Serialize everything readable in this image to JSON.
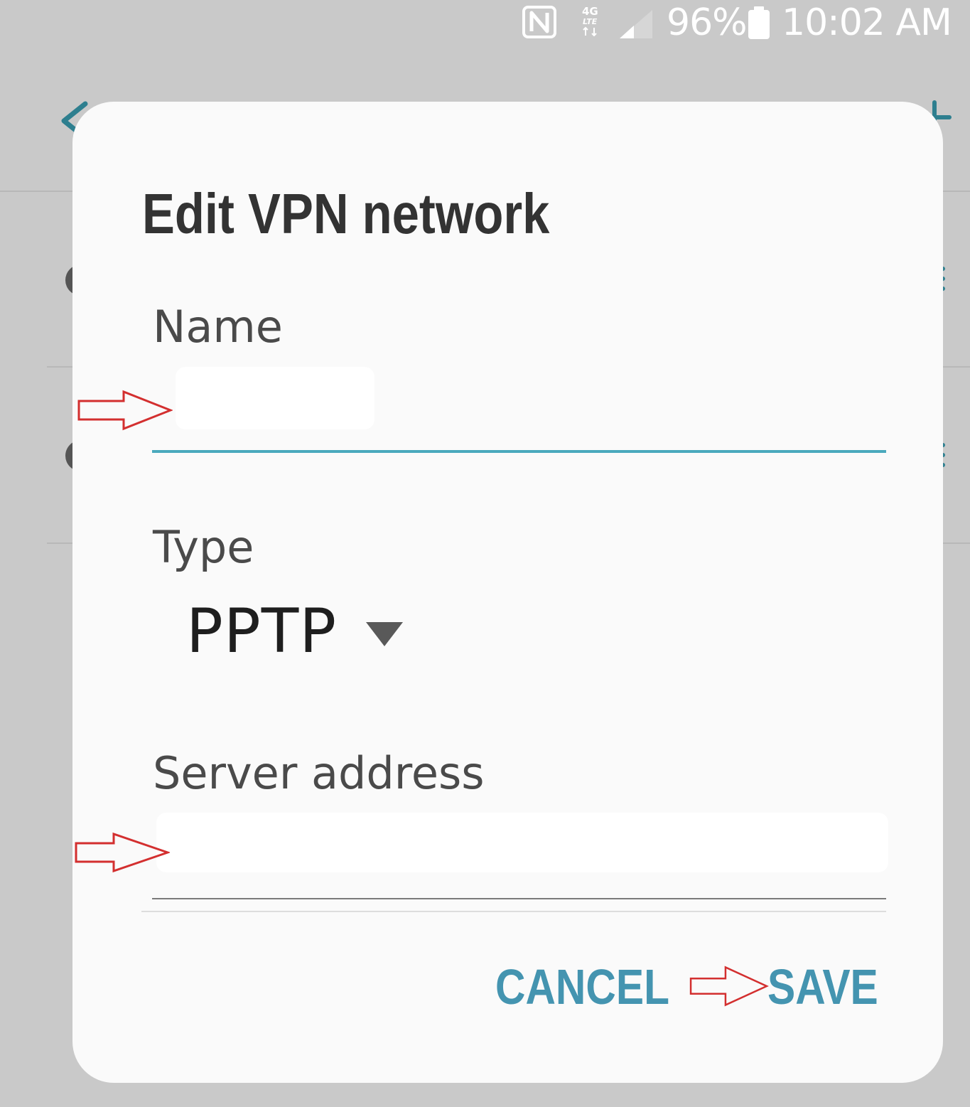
{
  "status_bar": {
    "nfc_icon": "nfc-icon",
    "network_icon": "lte-4g-icon",
    "signal_icon": "signal-strength-icon",
    "battery_percent": "96%",
    "battery_icon": "battery-icon",
    "time": "10:02 AM"
  },
  "background": {
    "back_icon": "back-arrow-icon",
    "add_icon": "add-icon"
  },
  "dialog": {
    "title": "Edit VPN network",
    "name_field": {
      "label": "Name",
      "value": ""
    },
    "type_field": {
      "label": "Type",
      "value": "PPTP",
      "icon": "dropdown-triangle-icon"
    },
    "server_field": {
      "label": "Server address",
      "value": ""
    },
    "buttons": {
      "cancel": "CANCEL",
      "save": "SAVE"
    }
  },
  "colors": {
    "accent": "#4494b0",
    "focused_underline": "#4aa9bd",
    "annotation_arrow": "#d32f2f",
    "scrim_background": "#c9c9c9",
    "dialog_background": "#fafafa"
  }
}
